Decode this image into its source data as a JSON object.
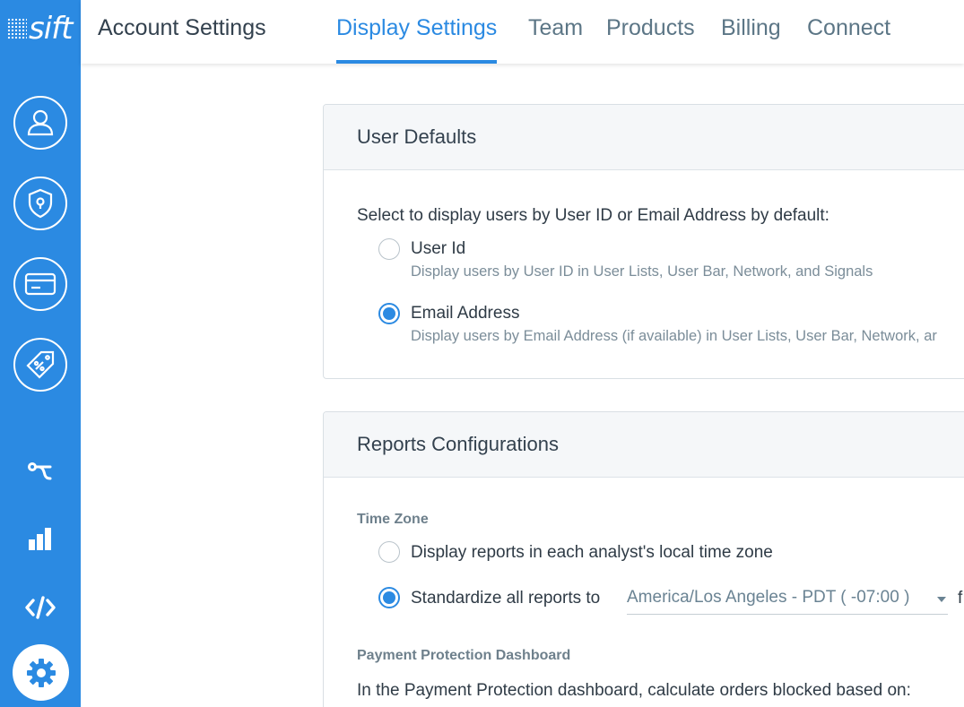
{
  "brand": {
    "logo_text": "sift",
    "accent": "#2b8ae2"
  },
  "rail": {
    "items": [
      {
        "name": "account",
        "icon": "user-icon"
      },
      {
        "name": "security",
        "icon": "shield-lock-icon"
      },
      {
        "name": "payments",
        "icon": "credit-card-icon"
      },
      {
        "name": "promotions",
        "icon": "discount-tag-icon"
      },
      {
        "name": "workflows",
        "icon": "workflow-icon"
      },
      {
        "name": "reports",
        "icon": "bar-chart-icon"
      },
      {
        "name": "developer",
        "icon": "code-icon"
      },
      {
        "name": "settings",
        "icon": "gear-icon",
        "active": true
      }
    ]
  },
  "header": {
    "title": "Account Settings",
    "tabs": [
      {
        "label": "Display Settings",
        "active": true
      },
      {
        "label": "Team"
      },
      {
        "label": "Products"
      },
      {
        "label": "Billing"
      },
      {
        "label": "Connect"
      }
    ]
  },
  "user_defaults": {
    "title": "User Defaults",
    "prompt": "Select to display users by User ID or Email Address by default:",
    "options": [
      {
        "label": "User Id",
        "description": "Display users by User ID in User Lists, User Bar, Network, and Signals",
        "selected": false
      },
      {
        "label": "Email Address",
        "description": "Display users by Email Address (if available) in User Lists, User Bar, Network, ar",
        "selected": true
      }
    ]
  },
  "reports": {
    "title": "Reports Configurations",
    "time_zone_label": "Time Zone",
    "options": [
      {
        "label": "Display reports in each analyst's local time zone",
        "selected": false
      },
      {
        "label": "Standardize all reports to",
        "selected": true
      }
    ],
    "timezone_value": "America/Los Angeles - PDT ( -07:00 )",
    "trailing_text": "f",
    "ppd_label": "Payment Protection Dashboard",
    "ppd_text": "In the Payment Protection dashboard, calculate orders blocked based on:"
  }
}
